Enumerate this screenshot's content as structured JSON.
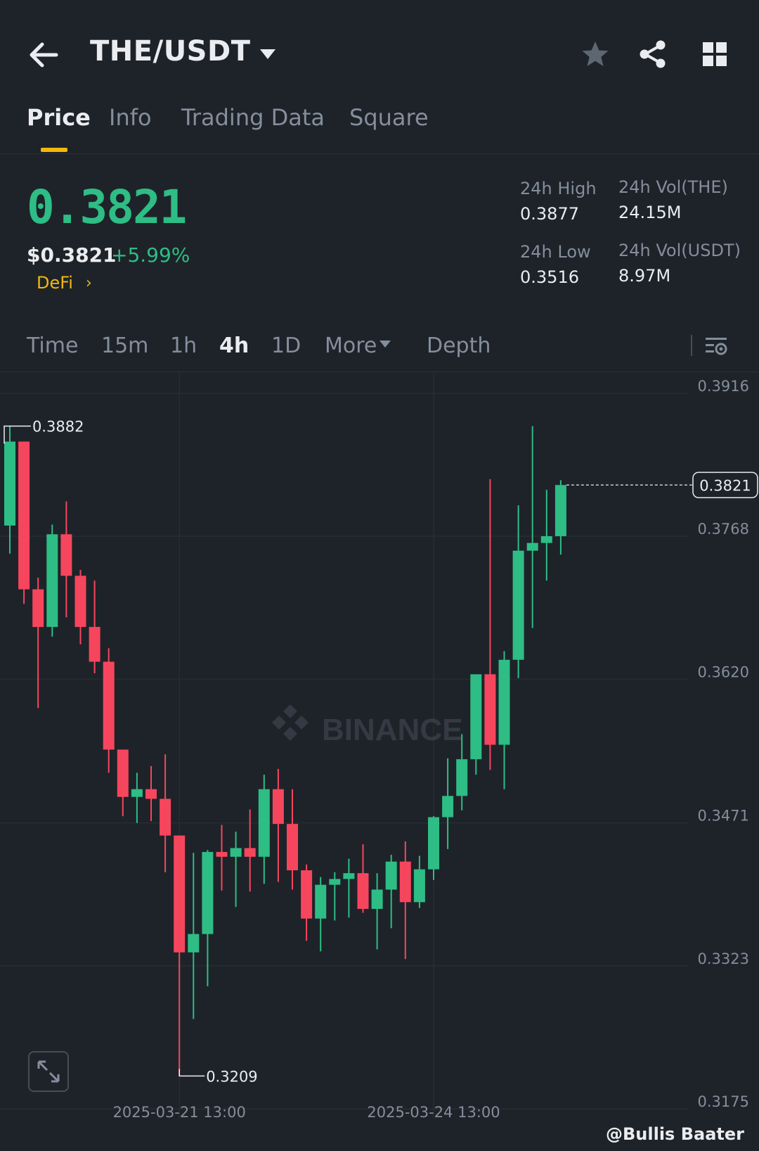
{
  "header": {
    "pair": "THE/USDT",
    "icons": [
      "back-arrow-icon",
      "caret-down-icon",
      "star-icon",
      "share-icon",
      "grid-icon"
    ]
  },
  "tabs": [
    {
      "label": "Price",
      "active": true
    },
    {
      "label": "Info",
      "active": false
    },
    {
      "label": "Trading Data",
      "active": false
    },
    {
      "label": "Square",
      "active": false
    }
  ],
  "summary": {
    "last_price": "0.3821",
    "usd_price": "$0.3821",
    "change": "+5.99%",
    "tag": "DeFi",
    "high_label": "24h High",
    "high_value": "0.3877",
    "low_label": "24h Low",
    "low_value": "0.3516",
    "vol_base_label": "24h Vol(THE)",
    "vol_base_value": "24.15M",
    "vol_quote_label": "24h Vol(USDT)",
    "vol_quote_value": "8.97M"
  },
  "timeframes": {
    "items": [
      "Time",
      "15m",
      "1h",
      "4h",
      "1D",
      "More",
      "Depth"
    ],
    "active": "4h"
  },
  "colors": {
    "up": "#2ebd85",
    "down": "#f6465d",
    "accent": "#f0b90b",
    "background": "#1e2329"
  },
  "chart_data": {
    "type": "candlestick",
    "y_ticks": [
      "0.3916",
      "0.3768",
      "0.3620",
      "0.3471",
      "0.3323",
      "0.3175"
    ],
    "ylim": [
      0.3175,
      0.3916
    ],
    "x_ticks": [
      "2025-03-21 13:00",
      "2025-03-24 13:00"
    ],
    "x_tick_index": [
      12,
      30
    ],
    "last_price_label": "0.3821",
    "last_price": 0.3821,
    "high_marker": "0.3882",
    "high_value": 0.3882,
    "high_index": 0,
    "low_marker": "0.3209",
    "low_value": 0.3209,
    "low_index": 12,
    "watermark": "BINANCE",
    "candles": [
      {
        "o": 0.3779,
        "h": 0.3882,
        "l": 0.375,
        "c": 0.3866
      },
      {
        "o": 0.3866,
        "h": 0.3866,
        "l": 0.3698,
        "c": 0.3713
      },
      {
        "o": 0.3713,
        "h": 0.3725,
        "l": 0.359,
        "c": 0.3674
      },
      {
        "o": 0.3674,
        "h": 0.378,
        "l": 0.3664,
        "c": 0.377
      },
      {
        "o": 0.377,
        "h": 0.3804,
        "l": 0.3684,
        "c": 0.3727
      },
      {
        "o": 0.3727,
        "h": 0.3733,
        "l": 0.3656,
        "c": 0.3674
      },
      {
        "o": 0.3674,
        "h": 0.3722,
        "l": 0.3626,
        "c": 0.3638
      },
      {
        "o": 0.3638,
        "h": 0.3652,
        "l": 0.3523,
        "c": 0.3547
      },
      {
        "o": 0.3547,
        "h": 0.3547,
        "l": 0.3478,
        "c": 0.3498
      },
      {
        "o": 0.3498,
        "h": 0.3523,
        "l": 0.3471,
        "c": 0.3506
      },
      {
        "o": 0.3506,
        "h": 0.353,
        "l": 0.3473,
        "c": 0.3496
      },
      {
        "o": 0.3496,
        "h": 0.3542,
        "l": 0.342,
        "c": 0.3458
      },
      {
        "o": 0.3458,
        "h": 0.3458,
        "l": 0.3209,
        "c": 0.3337
      },
      {
        "o": 0.3337,
        "h": 0.344,
        "l": 0.3268,
        "c": 0.3356
      },
      {
        "o": 0.3356,
        "h": 0.3443,
        "l": 0.3302,
        "c": 0.3441
      },
      {
        "o": 0.3441,
        "h": 0.3469,
        "l": 0.3401,
        "c": 0.3436
      },
      {
        "o": 0.3436,
        "h": 0.3462,
        "l": 0.3384,
        "c": 0.3445
      },
      {
        "o": 0.3445,
        "h": 0.3485,
        "l": 0.34,
        "c": 0.3436
      },
      {
        "o": 0.3436,
        "h": 0.3521,
        "l": 0.3408,
        "c": 0.3506
      },
      {
        "o": 0.3506,
        "h": 0.3527,
        "l": 0.341,
        "c": 0.347
      },
      {
        "o": 0.347,
        "h": 0.3506,
        "l": 0.3402,
        "c": 0.3422
      },
      {
        "o": 0.3422,
        "h": 0.3428,
        "l": 0.3349,
        "c": 0.3372
      },
      {
        "o": 0.3372,
        "h": 0.3415,
        "l": 0.3338,
        "c": 0.3407
      },
      {
        "o": 0.3407,
        "h": 0.342,
        "l": 0.337,
        "c": 0.3413
      },
      {
        "o": 0.3413,
        "h": 0.3434,
        "l": 0.3373,
        "c": 0.3419
      },
      {
        "o": 0.3419,
        "h": 0.3449,
        "l": 0.3378,
        "c": 0.3382
      },
      {
        "o": 0.3382,
        "h": 0.3419,
        "l": 0.334,
        "c": 0.3402
      },
      {
        "o": 0.3402,
        "h": 0.3438,
        "l": 0.3362,
        "c": 0.3431
      },
      {
        "o": 0.3431,
        "h": 0.3452,
        "l": 0.333,
        "c": 0.3389
      },
      {
        "o": 0.3389,
        "h": 0.3437,
        "l": 0.3383,
        "c": 0.3423
      },
      {
        "o": 0.3423,
        "h": 0.3478,
        "l": 0.3412,
        "c": 0.3477
      },
      {
        "o": 0.3477,
        "h": 0.3538,
        "l": 0.3444,
        "c": 0.3499
      },
      {
        "o": 0.3499,
        "h": 0.3563,
        "l": 0.3484,
        "c": 0.3537
      },
      {
        "o": 0.3537,
        "h": 0.3623,
        "l": 0.3521,
        "c": 0.3625
      },
      {
        "o": 0.3625,
        "h": 0.3827,
        "l": 0.3526,
        "c": 0.3552
      },
      {
        "o": 0.3552,
        "h": 0.3649,
        "l": 0.3506,
        "c": 0.364
      },
      {
        "o": 0.364,
        "h": 0.38,
        "l": 0.3621,
        "c": 0.3753
      },
      {
        "o": 0.3753,
        "h": 0.3882,
        "l": 0.3673,
        "c": 0.3761
      },
      {
        "o": 0.3761,
        "h": 0.3816,
        "l": 0.3722,
        "c": 0.3768
      },
      {
        "o": 0.3768,
        "h": 0.3826,
        "l": 0.3749,
        "c": 0.3821
      }
    ]
  },
  "footer": {
    "credit": "@Bullis Baater",
    "expand_icon": "expand-icon",
    "settings_icon": "chart-settings-icon"
  }
}
